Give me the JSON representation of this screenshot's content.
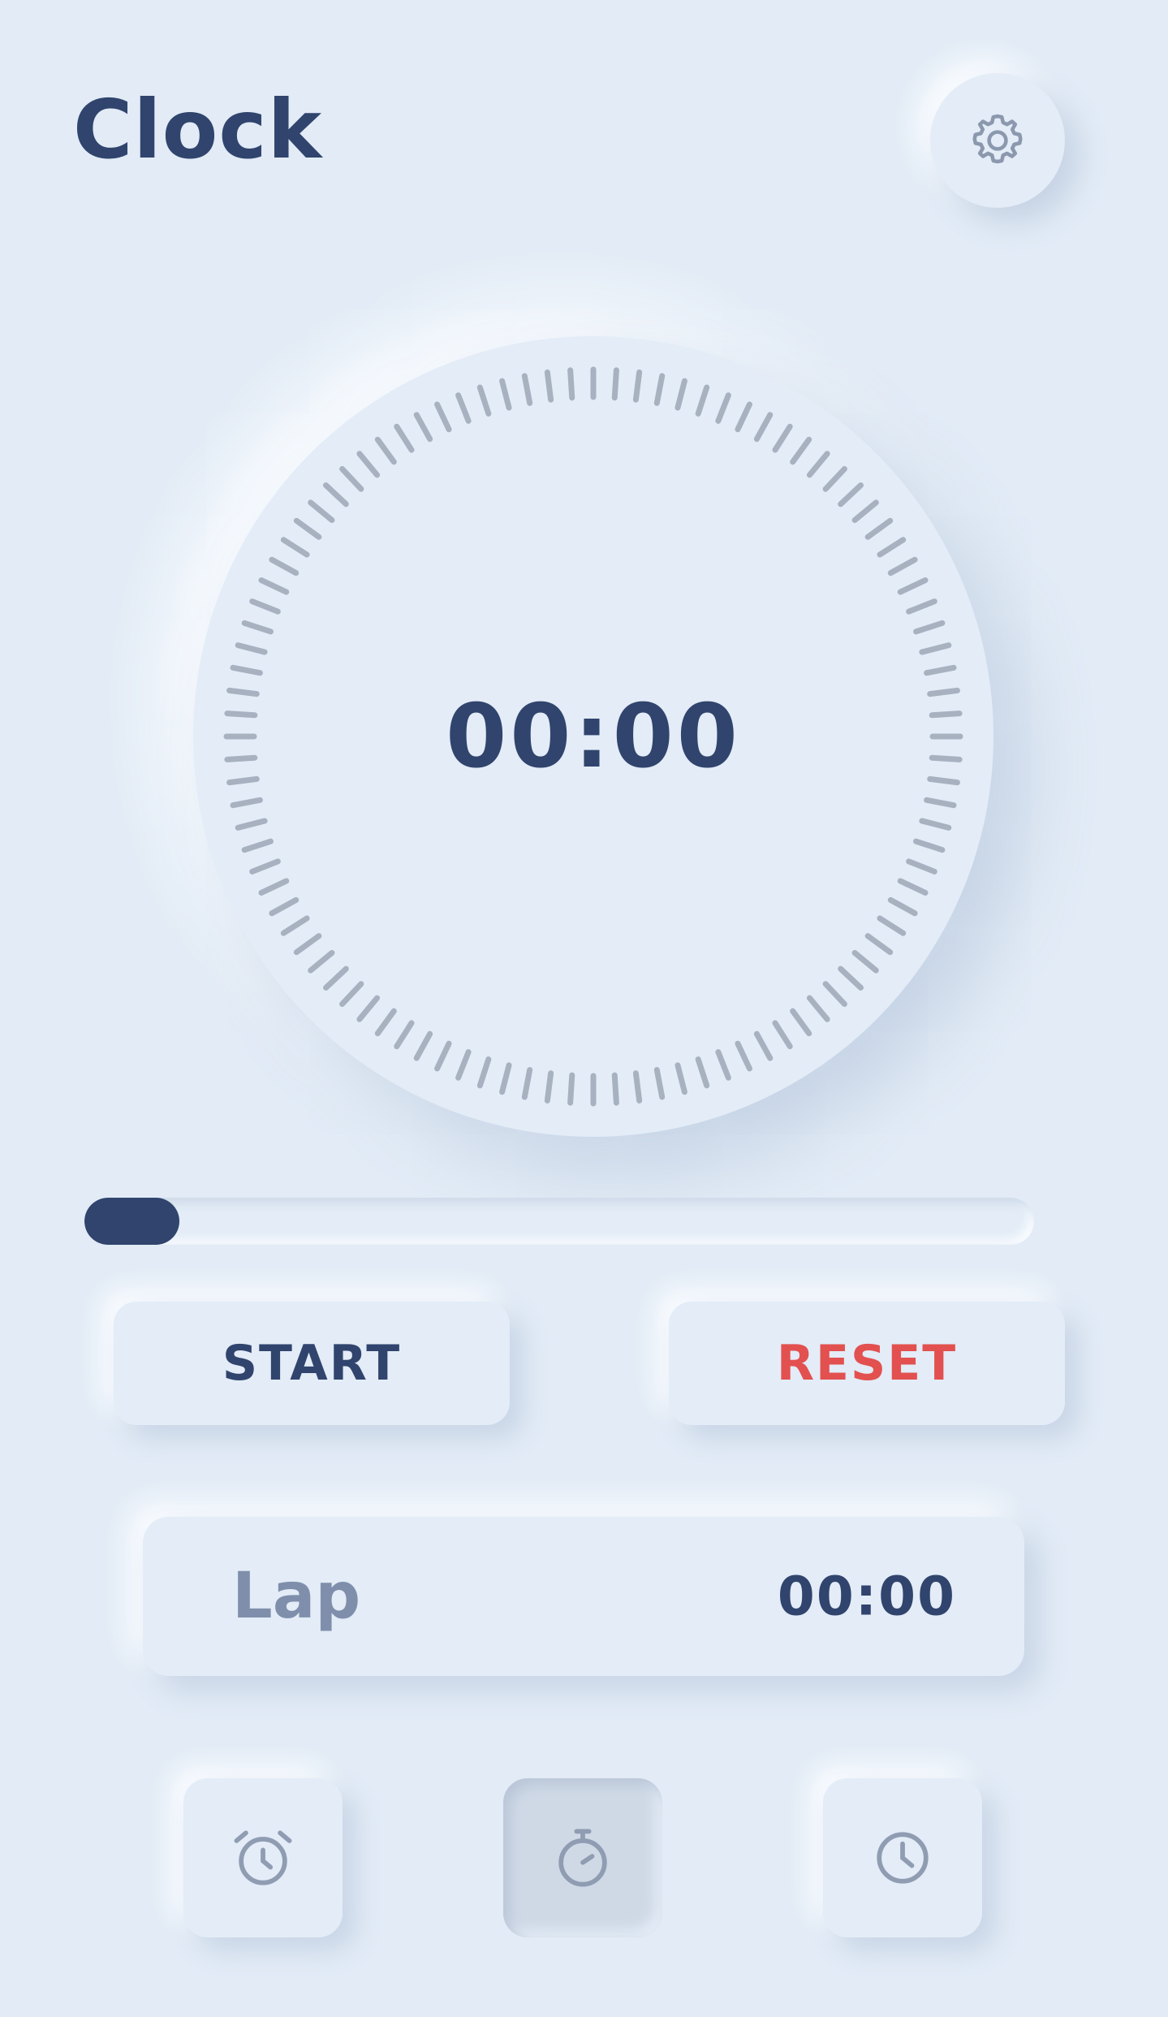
{
  "header": {
    "title": "Clock",
    "settings_icon": "gear-icon"
  },
  "stopwatch": {
    "time": "00:00",
    "tick_count": 100,
    "progress": 0.1
  },
  "controls": {
    "start_label": "START",
    "reset_label": "RESET"
  },
  "lap": {
    "label": "Lap",
    "time": "00:00"
  },
  "nav": {
    "items": [
      {
        "name": "alarm",
        "icon": "alarm-clock-icon",
        "active": false
      },
      {
        "name": "stopwatch",
        "icon": "stopwatch-icon",
        "active": true
      },
      {
        "name": "clock",
        "icon": "clock-icon",
        "active": false
      }
    ]
  },
  "colors": {
    "background": "#e2ebf6",
    "primary": "#30446d",
    "danger": "#e2514f",
    "muted": "#7f8fab",
    "tick": "#a7b1c0"
  }
}
